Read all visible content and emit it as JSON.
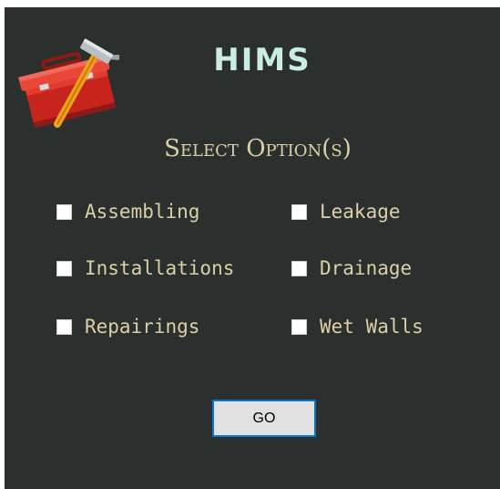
{
  "app": {
    "title": "HIMS",
    "subtitle": "Select Option(s)",
    "logo_icon": "toolbox-hammer-icon"
  },
  "options": [
    {
      "label": "Assembling",
      "checked": false
    },
    {
      "label": "Leakage",
      "checked": false
    },
    {
      "label": "Installations",
      "checked": false
    },
    {
      "label": "Drainage",
      "checked": false
    },
    {
      "label": "Repairings",
      "checked": false
    },
    {
      "label": "Wet Walls",
      "checked": false
    }
  ],
  "go_button": {
    "label": "GO"
  },
  "colors": {
    "background": "#2b2f2d",
    "title": "#c9ece4",
    "text": "#dcd0a6",
    "button_border": "#0078d7"
  }
}
